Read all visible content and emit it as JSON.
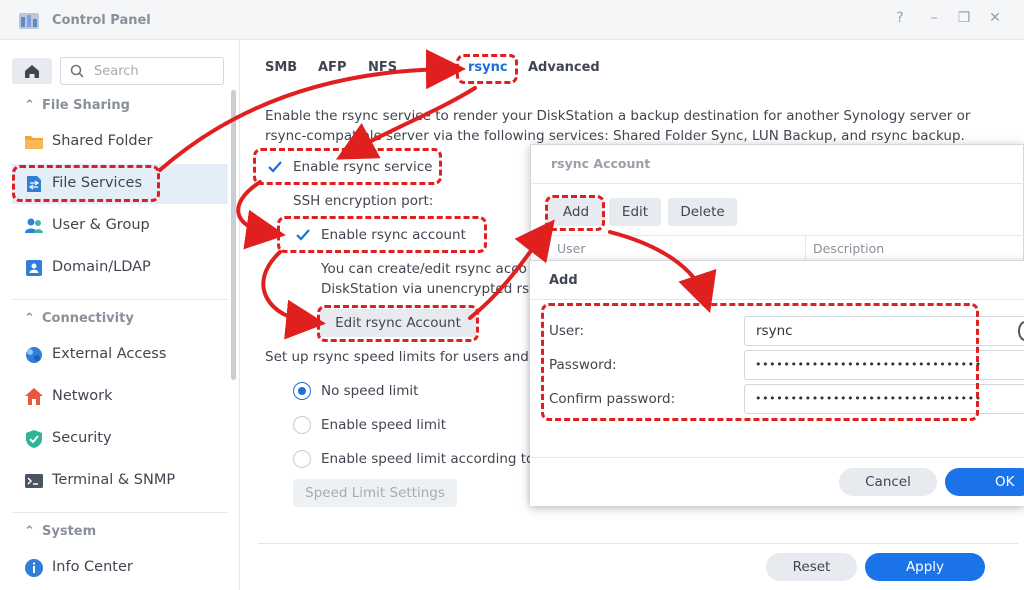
{
  "window": {
    "title": "Control Panel",
    "controls": {
      "help": "?",
      "minimize": "–",
      "restore": "❐",
      "close": "✕"
    }
  },
  "sidebar": {
    "search_placeholder": "Search",
    "sections": [
      {
        "label": "File Sharing",
        "items": [
          {
            "label": "Shared Folder",
            "icon": "folder-icon"
          },
          {
            "label": "File Services",
            "icon": "file-services-icon",
            "active": true
          }
        ]
      },
      {
        "label": "",
        "items": [
          {
            "label": "User & Group",
            "icon": "user-group-icon"
          },
          {
            "label": "Domain/LDAP",
            "icon": "domain-icon"
          }
        ]
      },
      {
        "label": "Connectivity",
        "items": [
          {
            "label": "External Access",
            "icon": "external-access-icon"
          },
          {
            "label": "Network",
            "icon": "network-icon"
          },
          {
            "label": "Security",
            "icon": "shield-icon"
          },
          {
            "label": "Terminal & SNMP",
            "icon": "terminal-icon"
          }
        ]
      },
      {
        "label": "System",
        "items": [
          {
            "label": "Info Center",
            "icon": "info-icon"
          }
        ]
      }
    ]
  },
  "tabs": [
    {
      "label": "SMB"
    },
    {
      "label": "AFP"
    },
    {
      "label": "NFS"
    },
    {
      "label": "rsync",
      "active": true
    },
    {
      "label": "Advanced"
    }
  ],
  "rsync": {
    "description_line1": "Enable the rsync service to render your DiskStation a backup destination for another Synology server or",
    "description_line2": "rsync-compatible server via the following services: Shared Folder Sync, LUN Backup, and rsync backup.",
    "enable_service": {
      "label": "Enable rsync service",
      "checked": true
    },
    "ssh_port_label": "SSH encryption port:",
    "enable_account": {
      "label": "Enable rsync account",
      "checked": true
    },
    "account_desc_line1": "You can create/edit rsync acco",
    "account_desc_line2": "DiskStation via unencrypted rsy",
    "edit_account_button": "Edit rsync Account",
    "speed_limit_heading": "Set up rsync speed limits for users and",
    "speed_options": [
      {
        "label": "No speed limit",
        "selected": true
      },
      {
        "label": "Enable speed limit",
        "selected": false
      },
      {
        "label": "Enable speed limit according to",
        "selected": false
      }
    ],
    "speed_settings_button": "Speed Limit Settings"
  },
  "footer": {
    "reset": "Reset",
    "apply": "Apply"
  },
  "account_dialog": {
    "title": "rsync Account",
    "buttons": {
      "add": "Add",
      "edit": "Edit",
      "delete": "Delete"
    },
    "columns": [
      "User",
      "Description"
    ]
  },
  "add_dialog": {
    "title": "Add",
    "user_label": "User:",
    "user_value": "rsync",
    "password_label": "Password:",
    "password_value": "••••••••••••••••••••••••••••••••",
    "confirm_label": "Confirm password:",
    "confirm_value": "••••••••••••••••••••••••••••••••",
    "cancel": "Cancel",
    "ok": "OK"
  },
  "colors": {
    "accent": "#1a73e8",
    "annotation": "#e01f1f",
    "active_nav": "#e3eef9"
  }
}
